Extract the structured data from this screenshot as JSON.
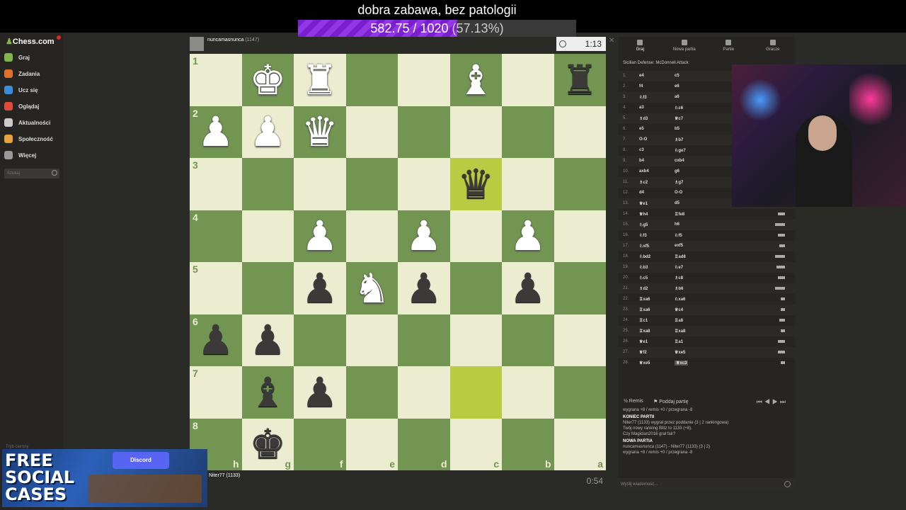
{
  "overlay": {
    "title": "dobra zabawa, bez patologii",
    "progress_text": "582.75 / 1020",
    "progress_pct": " (57.13%)",
    "progress_fraction": 0.5713
  },
  "nav": {
    "logo": "Chess.com",
    "items": [
      {
        "label": "Graj",
        "color": "#81b64c"
      },
      {
        "label": "Zadania",
        "color": "#e0702a"
      },
      {
        "label": "Ucz się",
        "color": "#3a8fd8"
      },
      {
        "label": "Oglądaj",
        "color": "#e04a3a"
      },
      {
        "label": "Aktualności",
        "color": "#ccc"
      },
      {
        "label": "Społeczność",
        "color": "#e6a23c"
      },
      {
        "label": "Więcej",
        "color": "#999"
      }
    ],
    "search_placeholder": "Szukaj",
    "tryb": "Tryb ciemny"
  },
  "game": {
    "top_player": "nuncamasnunca",
    "top_rating": "(1147)",
    "top_clock": "1:13",
    "bottom_player": "Niter77",
    "bottom_rating": "(1133)",
    "bottom_clock": "0:54",
    "ranks": [
      "1",
      "2",
      "3",
      "4",
      "5",
      "6",
      "7",
      "8"
    ],
    "files": [
      "h",
      "g",
      "f",
      "e",
      "d",
      "c",
      "b",
      "a"
    ],
    "board": [
      [
        "",
        "wK",
        "wR",
        "",
        "",
        "wB",
        "",
        "bR"
      ],
      [
        "wP",
        "wP",
        "wQ",
        "",
        "",
        "",
        "",
        ""
      ],
      [
        "",
        "",
        "",
        "",
        "",
        "bQ",
        "",
        ""
      ],
      [
        "",
        "",
        "wP",
        "",
        "wP",
        "",
        "wP",
        ""
      ],
      [
        "",
        "",
        "bP",
        "wN",
        "bP",
        "",
        "bP",
        ""
      ],
      [
        "bP",
        "bP",
        "",
        "",
        "",
        "",
        "",
        ""
      ],
      [
        "",
        "bB",
        "bP",
        "",
        "",
        "",
        "",
        ""
      ],
      [
        "",
        "bK",
        "",
        "",
        "",
        "",
        "",
        ""
      ]
    ],
    "highlights": [
      [
        2,
        5
      ],
      [
        6,
        5
      ]
    ]
  },
  "panel": {
    "tabs": [
      "Graj",
      "Nowa partia",
      "Partie",
      "Gracze"
    ],
    "opening": "Sicilian Defense: McDonnell Attack",
    "moves": [
      [
        "1.",
        "e4",
        "c5",
        0
      ],
      [
        "2.",
        "f4",
        "e6",
        0
      ],
      [
        "3.",
        "♘f3",
        "a6",
        0
      ],
      [
        "4.",
        "a3",
        "♘c6",
        0
      ],
      [
        "5.",
        "♗d3",
        "♕c7",
        0
      ],
      [
        "6.",
        "e5",
        "b5",
        0
      ],
      [
        "7.",
        "O-O",
        "♗b7",
        0
      ],
      [
        "8.",
        "c3",
        "♘ge7",
        0
      ],
      [
        "9.",
        "b4",
        "cxb4",
        0
      ],
      [
        "10.",
        "axb4",
        "g6",
        0
      ],
      [
        "11.",
        "♗c2",
        "♗g7",
        0
      ],
      [
        "12.",
        "d4",
        "O-O",
        0
      ],
      [
        "13.",
        "♕e1",
        "d5",
        0
      ],
      [
        "14.",
        "♕h4",
        "♖fe8",
        10
      ],
      [
        "15.",
        "♘g5",
        "h6",
        14
      ],
      [
        "16.",
        "♘f3",
        "♘f5",
        10
      ],
      [
        "17.",
        "♘xf5",
        "exf5",
        8
      ],
      [
        "18.",
        "♘bd2",
        "♖ad8",
        14
      ],
      [
        "19.",
        "♘b3",
        "♘e7",
        12
      ],
      [
        "20.",
        "♘c5",
        "♗c8",
        10
      ],
      [
        "21.",
        "♗d2",
        "♗b6",
        14
      ],
      [
        "22.",
        "♖xa6",
        "♘xa6",
        6
      ],
      [
        "23.",
        "♖xa6",
        "♕c4",
        6
      ],
      [
        "24.",
        "♖c1",
        "♖a8",
        8
      ],
      [
        "25.",
        "♖xa8",
        "♖xa8",
        6
      ],
      [
        "26.",
        "♕e1",
        "♖a1",
        10
      ],
      [
        "27.",
        "♕f2",
        "♕xe5",
        10
      ],
      [
        "28.",
        "♕xe5",
        "♕xc3",
        6
      ]
    ],
    "chat_buttons": {
      "draw": "Remis",
      "resign": "Poddaj partię"
    }
  },
  "chat": {
    "lines": [
      {
        "t": "wygrana +8 / remis +0 / przegrana -8",
        "cls": ""
      },
      {
        "t": "KONIEC PARTII",
        "cls": "hd"
      },
      {
        "t": "Niter77 (1133) wygrał przez poddanie (3 | 2 rankingowa)",
        "cls": ""
      },
      {
        "t": "Twój nowy ranking Blitz to 1133 (+8).",
        "cls": ""
      },
      {
        "t": "Czy Magiclan2016 grał fair?",
        "cls": ""
      },
      {
        "t": "NOWA PARTIA",
        "cls": "hd"
      },
      {
        "t": "nuncamasnunca (1147) - Niter77 (1133) (3 | 2)",
        "cls": ""
      },
      {
        "t": "wygrana +8 / remis +0 / przegrana -8",
        "cls": ""
      }
    ],
    "input_placeholder": "Wyślij wiadomość..."
  },
  "promo": {
    "line1": "FREE",
    "line2": "SOCIAL",
    "line3": "CASES",
    "discord": "Discord"
  }
}
